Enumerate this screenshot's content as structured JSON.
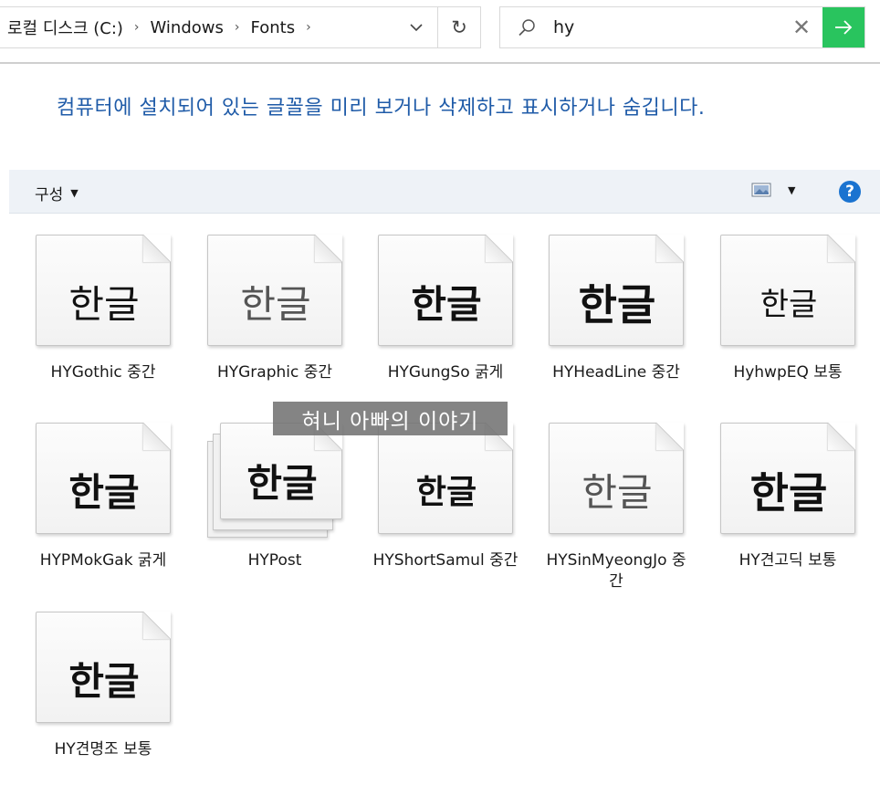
{
  "address": {
    "crumbs": [
      "로컬 디스크 (C:)",
      "Windows",
      "Fonts"
    ],
    "separator": "›",
    "dropdown_glyph": "⌄",
    "refresh_glyph": "↻"
  },
  "search": {
    "value": "hy",
    "clear_glyph": "✕",
    "go_glyph": "→"
  },
  "description": "컴퓨터에 설치되어 있는 글꼴을 미리 보거나 삭제하고 표시하거나 숨깁니다.",
  "toolbar": {
    "organize_label": "구성",
    "organize_arrow": "▼",
    "view_arrow": "▼",
    "help_label": "?"
  },
  "accent_colors": {
    "go_button": "#29c45e",
    "description_text": "#1f5ba8",
    "help_button": "#1a73d0"
  },
  "fonts": [
    {
      "sample": "한글",
      "name": "HYGothic 중간",
      "style": "gothic"
    },
    {
      "sample": "한글",
      "name": "HYGraphic 중간",
      "style": "graphic"
    },
    {
      "sample": "한글",
      "name": "HYGungSo 굵게",
      "style": "gungso"
    },
    {
      "sample": "한글",
      "name": "HYHeadLine 중간",
      "style": "headline"
    },
    {
      "sample": "한글",
      "name": "HyhwpEQ 보통",
      "style": "eq"
    },
    {
      "sample": "한글",
      "name": "HYPMokGak 굵게",
      "style": "mokgak"
    },
    {
      "sample": "한글",
      "name": "HYPost",
      "style": "post"
    },
    {
      "sample": "한글",
      "name": "HYShortSamul 중간",
      "style": "samul"
    },
    {
      "sample": "한글",
      "name": "HYSinMyeongJo 중간",
      "style": "myeongjo"
    },
    {
      "sample": "한글",
      "name": "HY견고딕 보통",
      "style": "gyeongothic"
    },
    {
      "sample": "한글",
      "name": "HY견명조 보통",
      "style": "gyeonmyeongjo"
    }
  ],
  "watermark": "혀니 아빠의 이야기"
}
